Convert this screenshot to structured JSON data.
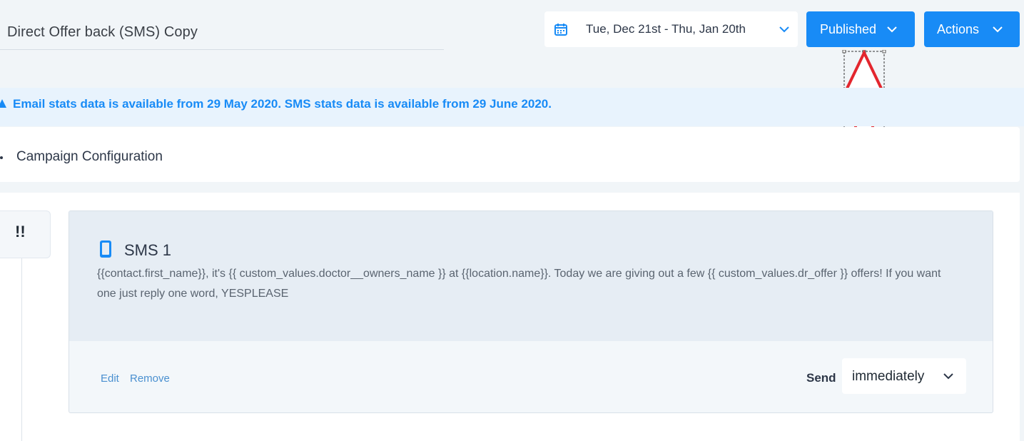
{
  "header": {
    "campaign_name": "Direct Offer back (SMS) Copy",
    "date_range": "Tue, Dec 21st - Thu, Jan 20th",
    "published_label": "Published",
    "actions_label": "Actions"
  },
  "banner": {
    "text": "Email stats data is available from 29 May 2020. SMS stats data is available from 29 June 2020."
  },
  "config": {
    "label": "Campaign Configuration"
  },
  "step": {
    "badge": "!!",
    "sms_title": "SMS 1",
    "message": "{{contact.first_name}}, it's {{ custom_values.doctor__owners_name }} at {{location.name}}. Today we are giving out a few {{ custom_values.dr_offer }} offers! If you want one just reply one word, YESPLEASE",
    "edit_label": "Edit",
    "remove_label": "Remove",
    "send_label": "Send",
    "send_value": "immediately"
  },
  "colors": {
    "primary": "#188bf6",
    "background": "#f1f5f8",
    "banner_bg": "#e8f3fd",
    "arrow": "#e3262e"
  },
  "icons": {
    "date": "calendar-icon",
    "dropdown": "chevron-down-icon",
    "sms": "phone-icon",
    "banner": "warning-icon",
    "annotation": "arrow-up-icon"
  }
}
